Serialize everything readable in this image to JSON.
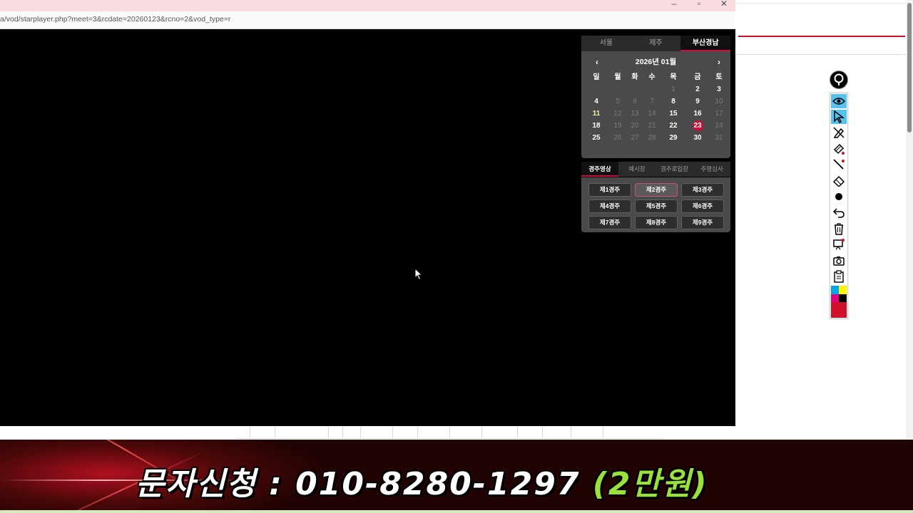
{
  "window": {
    "url": "a/vod/starplayer.php?meet=3&rcdate=20260123&rcno=2&vod_type=r",
    "minimize_glyph": "–",
    "maximize_glyph": "▫",
    "close_glyph": "✕"
  },
  "region_tabs": [
    {
      "label": "서울",
      "active": false
    },
    {
      "label": "제주",
      "active": false
    },
    {
      "label": "부산경남",
      "active": true
    }
  ],
  "calendar": {
    "title": "2026년 01월",
    "prev": "‹",
    "next": "›",
    "weekdays": [
      "일",
      "월",
      "화",
      "수",
      "목",
      "금",
      "토"
    ],
    "weeks": [
      [
        "",
        "",
        "",
        "",
        "1",
        "2",
        "3"
      ],
      [
        "4",
        "5",
        "6",
        "7",
        "8",
        "9",
        "10"
      ],
      [
        "11",
        "12",
        "13",
        "14",
        "15",
        "16",
        "17"
      ],
      [
        "18",
        "19",
        "20",
        "21",
        "22",
        "23",
        "24"
      ],
      [
        "25",
        "26",
        "27",
        "28",
        "29",
        "30",
        "31"
      ]
    ],
    "selected": "23",
    "highlighted": "11",
    "race_days": [
      "2",
      "3",
      "4",
      "8",
      "9",
      "11",
      "15",
      "16",
      "18",
      "22",
      "23",
      "25",
      "29",
      "30"
    ]
  },
  "lower_tabs": [
    {
      "label": "경주영상",
      "active": true
    },
    {
      "label": "예시장",
      "active": false
    },
    {
      "label": "경주로입장",
      "active": false
    },
    {
      "label": "주행심사",
      "active": false
    }
  ],
  "races": [
    {
      "label": "제1경주",
      "active": false
    },
    {
      "label": "제2경주",
      "active": true
    },
    {
      "label": "제3경주",
      "active": false
    },
    {
      "label": "제4경주",
      "active": false
    },
    {
      "label": "제5경주",
      "active": false
    },
    {
      "label": "제6경주",
      "active": false
    },
    {
      "label": "제7경주",
      "active": false
    },
    {
      "label": "제8경주",
      "active": false
    },
    {
      "label": "제9경주",
      "active": false
    }
  ],
  "toolbar": {
    "icons": [
      "eye-icon",
      "pointer-icon",
      "pen-off-icon",
      "highlighter-icon",
      "line-icon",
      "eraser-icon",
      "dot-icon",
      "undo-icon",
      "trash-icon",
      "screen-icon",
      "camera-icon",
      "clipboard-icon",
      "color-palette-icon"
    ],
    "active": [
      "eye-icon",
      "pointer-icon"
    ],
    "current_color": "#d0102a"
  },
  "banner": {
    "text": "문자신청 : 010-8280-1297",
    "accent": "(2만원)"
  },
  "colors": {
    "accent_red": "#d0103a",
    "titlebar": "#f9dbe0",
    "banner_green": "#9be13c"
  }
}
